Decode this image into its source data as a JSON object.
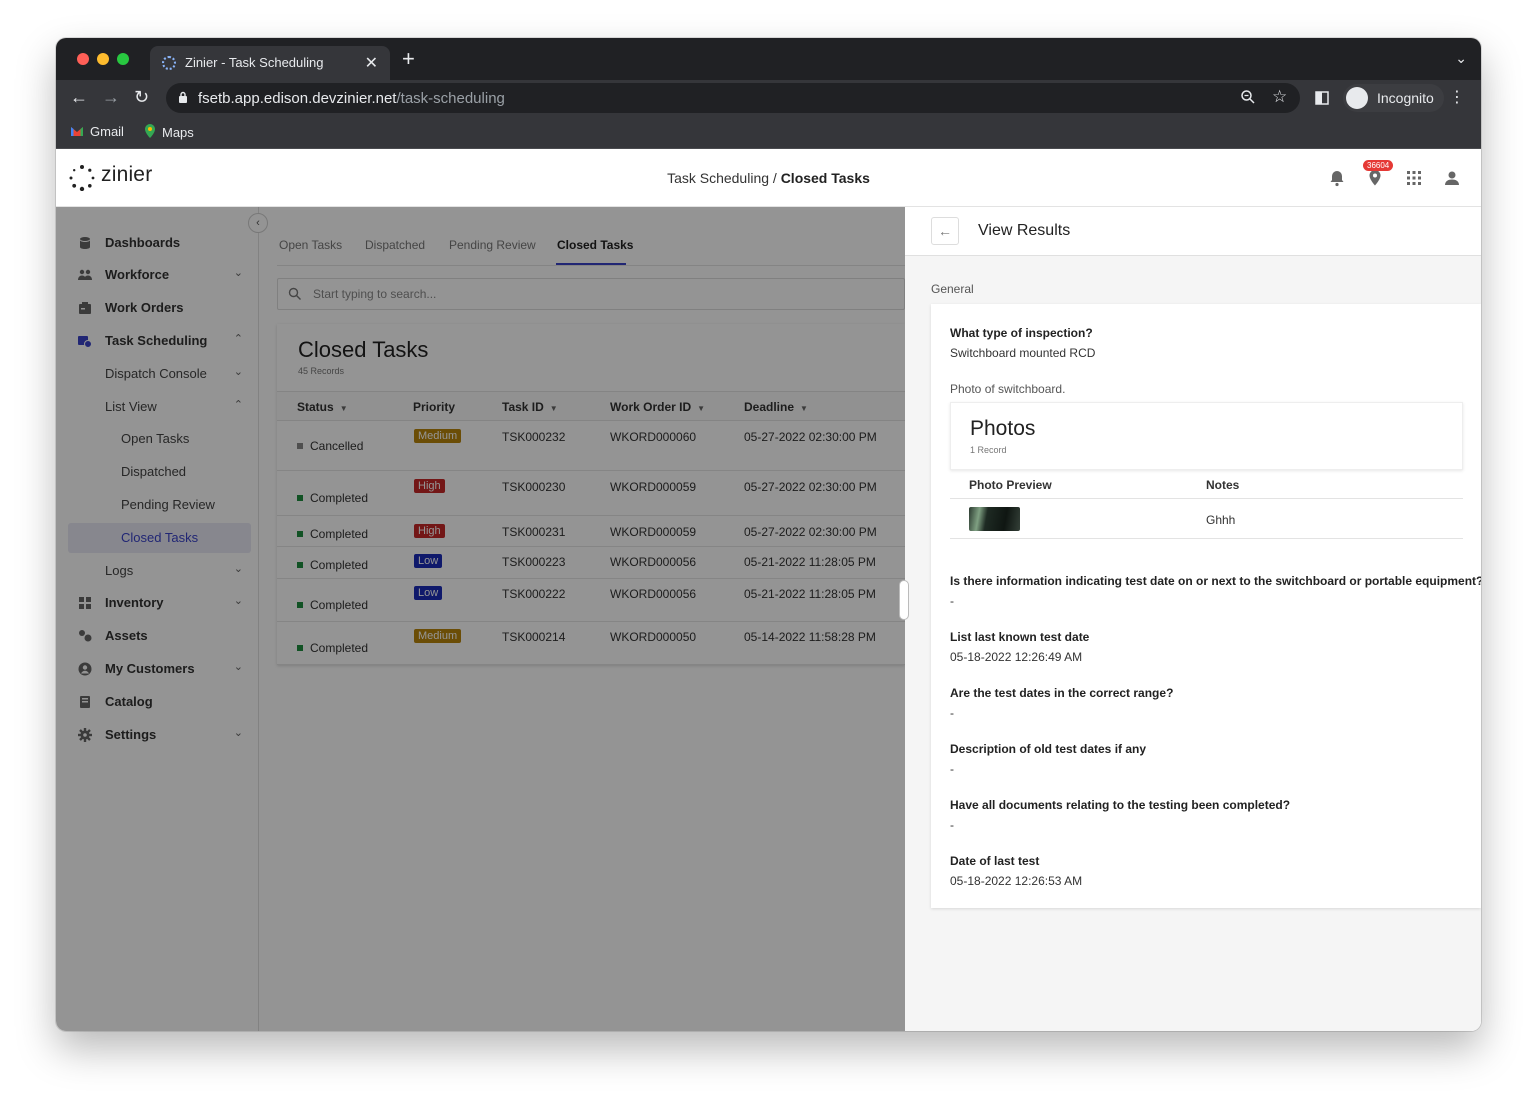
{
  "browser": {
    "tab_title": "Zinier - Task Scheduling",
    "url_host": "fsetb.app.edison.devzinier.net",
    "url_path": "/task-scheduling",
    "profile_label": "Incognito",
    "bookmarks": [
      "Gmail",
      "Maps"
    ]
  },
  "header": {
    "logo_text": "zinier",
    "breadcrumb_parent": "Task Scheduling /",
    "breadcrumb_current": "Closed Tasks",
    "notification_count": "36604"
  },
  "sidebar": {
    "items": [
      {
        "label": "Dashboards"
      },
      {
        "label": "Workforce"
      },
      {
        "label": "Work Orders"
      },
      {
        "label": "Task Scheduling"
      },
      {
        "label": "Dispatch Console"
      },
      {
        "label": "List View"
      },
      {
        "label": "Open Tasks"
      },
      {
        "label": "Dispatched"
      },
      {
        "label": "Pending Review"
      },
      {
        "label": "Closed Tasks"
      },
      {
        "label": "Logs"
      },
      {
        "label": "Inventory"
      },
      {
        "label": "Assets"
      },
      {
        "label": "My Customers"
      },
      {
        "label": "Catalog"
      },
      {
        "label": "Settings"
      }
    ]
  },
  "main": {
    "tabs": [
      "Open Tasks",
      "Dispatched",
      "Pending Review",
      "Closed Tasks"
    ],
    "search_placeholder": "Start typing to search...",
    "table_title": "Closed Tasks",
    "record_count": "45 Records",
    "columns": [
      "Status",
      "Priority",
      "Task ID",
      "Work Order ID",
      "Deadline"
    ],
    "rows": [
      {
        "status": "Cancelled",
        "priority": "Medium",
        "task_id": "TSK000232",
        "work_order": "WKORD000060",
        "deadline": "05-27-2022 02:30:00 PM"
      },
      {
        "status": "Completed",
        "priority": "High",
        "task_id": "TSK000230",
        "work_order": "WKORD000059",
        "deadline": "05-27-2022 02:30:00 PM"
      },
      {
        "status": "Completed",
        "priority": "High",
        "task_id": "TSK000231",
        "work_order": "WKORD000059",
        "deadline": "05-27-2022 02:30:00 PM"
      },
      {
        "status": "Completed",
        "priority": "Low",
        "task_id": "TSK000223",
        "work_order": "WKORD000056",
        "deadline": "05-21-2022 11:28:05 PM"
      },
      {
        "status": "Completed",
        "priority": "Low",
        "task_id": "TSK000222",
        "work_order": "WKORD000056",
        "deadline": "05-21-2022 11:28:05 PM"
      },
      {
        "status": "Completed",
        "priority": "Medium",
        "task_id": "TSK000214",
        "work_order": "WKORD000050",
        "deadline": "05-14-2022 11:58:28 PM"
      }
    ]
  },
  "panel": {
    "title": "View Results",
    "section": "General",
    "q_inspection": "What type of inspection?",
    "a_inspection": "Switchboard mounted RCD",
    "q_photo": "Photo of switchboard.",
    "photos_title": "Photos",
    "photos_count": "1 Record",
    "photos_col_preview": "Photo Preview",
    "photos_col_notes": "Notes",
    "photos_note": "Ghhh",
    "q_info": "Is there information indicating test date on or next to the switchboard or portable equipment?",
    "a_info": "-",
    "q_last_known": "List last known test date",
    "a_last_known": "05-18-2022 12:26:49 AM",
    "q_range": "Are the test dates in the correct range?",
    "a_range": "-",
    "q_old": "Description of old test dates if any",
    "a_old": "-",
    "q_docs": "Have all documents relating to the testing been completed?",
    "a_docs": "-",
    "q_last_test": "Date of last test",
    "a_last_test": "05-18-2022 12:26:53 AM"
  },
  "colors": {
    "accent": "#3a43c9",
    "priority_medium": "#b8860b",
    "priority_high": "#c62828",
    "priority_low": "#1a2bb8",
    "status_completed": "#1e8e3e",
    "status_cancelled": "#888888"
  }
}
